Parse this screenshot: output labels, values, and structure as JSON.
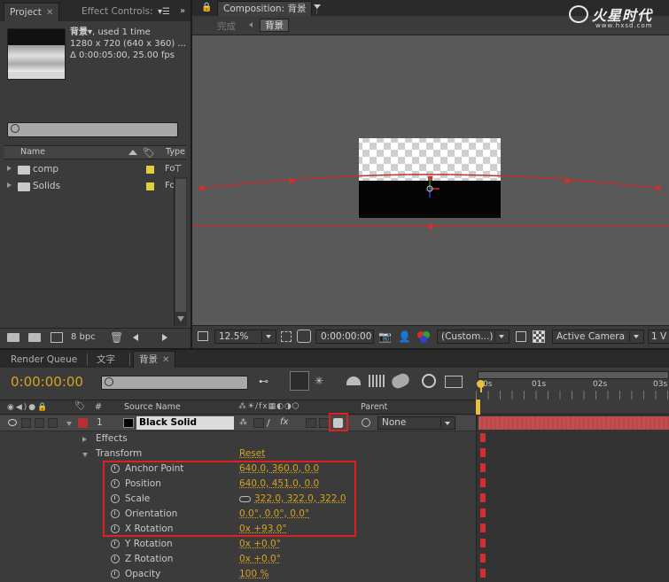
{
  "project_panel": {
    "tabs": [
      {
        "label": "Project",
        "active": true
      },
      {
        "label": "Effect Controls:",
        "active": false
      }
    ],
    "item_name": "背景▾",
    "item_usage": ", used 1 time",
    "item_resolution": "1280 x 720  (640 x 360) ...",
    "item_duration": "Δ 0:00:05:00, 25.00 fps",
    "search_placeholder": "",
    "columns": {
      "name": "Name",
      "type": "Type"
    },
    "items": [
      {
        "name": "comp",
        "label_color": "#e0d040",
        "type": "Fo"
      },
      {
        "name": "Solids",
        "label_color": "#e0d040",
        "type": "Fo"
      }
    ],
    "bpc": "8 bpc"
  },
  "comp_panel": {
    "title": "Composition: 背景",
    "breadcrumbs": [
      "完成",
      "背景"
    ],
    "zoom": "12.5%",
    "timecode": "0:00:00:00",
    "resolution": "(Custom...)",
    "camera": "Active Camera",
    "view": "1 V"
  },
  "watermark": {
    "brand": "火星时代",
    "url": "www.hxsd.com"
  },
  "timeline": {
    "tabs": [
      {
        "label": "Render Queue",
        "active": false
      },
      {
        "label": "文字",
        "active": false
      },
      {
        "label": "背景",
        "active": true
      }
    ],
    "current_time": "0:00:00:00",
    "search_placeholder": "",
    "ruler": [
      "0s",
      "01s",
      "02s",
      "03s"
    ],
    "headers": {
      "number": "#",
      "source": "Source Name",
      "parent": "Parent"
    },
    "layer": {
      "number": "1",
      "name": "Black Solid",
      "parent": "None",
      "color": "#b83030"
    },
    "properties": [
      {
        "label": "Effects",
        "indent": 1,
        "twirl": "closed"
      },
      {
        "label": "Transform",
        "indent": 1,
        "twirl": "open",
        "value": "Reset"
      },
      {
        "label": "Anchor Point",
        "indent": 2,
        "value": "640.0, 360.0, 0.0",
        "highlight": true
      },
      {
        "label": "Position",
        "indent": 2,
        "value": "640.0, 451.0, 0.0",
        "highlight": true
      },
      {
        "label": "Scale",
        "indent": 2,
        "value": "322.0, 322.0, 322.0",
        "highlight": true,
        "link": true
      },
      {
        "label": "Orientation",
        "indent": 2,
        "value": "0.0°, 0.0°, 0.0°",
        "highlight": true
      },
      {
        "label": "X Rotation",
        "indent": 2,
        "value": "0x +93.0°",
        "highlight": true
      },
      {
        "label": "Y Rotation",
        "indent": 2,
        "value": "0x +0.0°"
      },
      {
        "label": "Z Rotation",
        "indent": 2,
        "value": "0x +0.0°"
      },
      {
        "label": "Opacity",
        "indent": 2,
        "value": "100 %"
      }
    ]
  },
  "colors": {
    "highlight_box": "#e02020",
    "value_orange": "#d8a21f",
    "layer_bar": "#c05050",
    "motion_path": "#c03030"
  }
}
